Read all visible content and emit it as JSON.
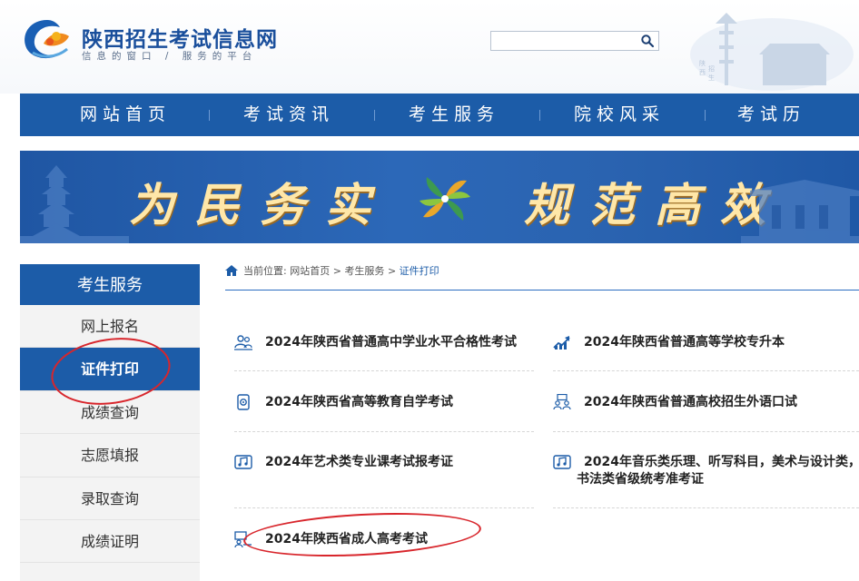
{
  "header": {
    "title": "陕西招生考试信息网",
    "subtitle": "信息的窗口 / 服务的平台",
    "search_placeholder": ""
  },
  "nav": {
    "items": [
      "网站首页",
      "考试资讯",
      "考生服务",
      "院校风采",
      "考试历"
    ]
  },
  "banner": {
    "left_text": "为民务实",
    "right_text": "规范高效"
  },
  "sidebar": {
    "title": "考生服务",
    "items": [
      "网上报名",
      "证件打印",
      "成绩查询",
      "志愿填报",
      "录取查询",
      "成绩证明"
    ],
    "active_index": 1
  },
  "breadcrumb": {
    "prefix": "当前位置:",
    "home": "网站首页",
    "section": "考生服务",
    "current": "证件打印",
    "separator": ">"
  },
  "exams": [
    {
      "label": "2024年陕西省普通高中学业水平合格性考试",
      "icon": "people-icon"
    },
    {
      "label": "2024年陕西省普通高等学校专升本",
      "icon": "chart-up-icon"
    },
    {
      "label": "2024年陕西省高等教育自学考试",
      "icon": "document-icon"
    },
    {
      "label": "2024年陕西省普通高校招生外语口试",
      "icon": "group-icon"
    },
    {
      "label": "2024年艺术类专业课考试报考证",
      "icon": "music-icon"
    },
    {
      "label_line1": "2024年音乐类乐理、听写科目，美术与设计类，",
      "label_line2": "书法类省级统考准考证",
      "icon": "music-icon"
    },
    {
      "label": "2024年陕西省成人高考考试",
      "icon": "teacher-icon"
    }
  ],
  "colors": {
    "primary": "#1c5ca8",
    "banner_text": "#ffe7a8",
    "highlight_circle": "#d8262c"
  }
}
